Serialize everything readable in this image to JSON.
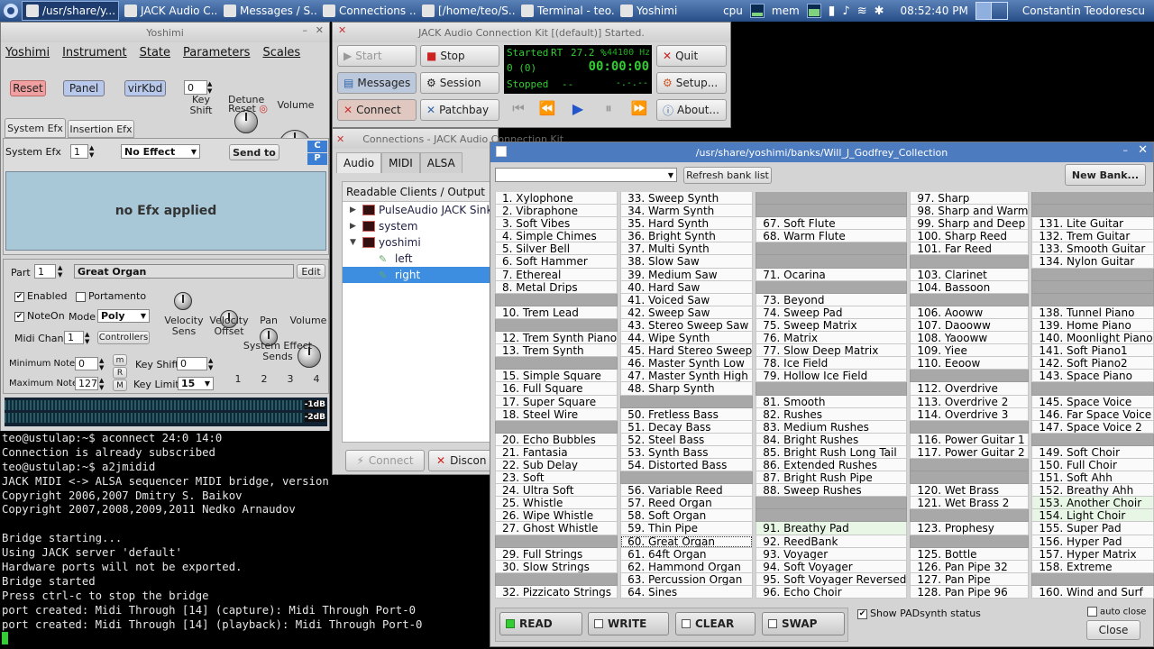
{
  "taskbar": {
    "tasks": [
      "/usr/share/y...",
      "JACK Audio C...",
      "Messages / S...",
      "Connections ...",
      "[/home/teo/S...",
      "Terminal - teo...",
      "Yoshimi"
    ],
    "cpu": "cpu",
    "mem": "mem",
    "clock": "08:52:40 PM",
    "user": "Constantin Teodorescu"
  },
  "yoshimi": {
    "title": "Yoshimi",
    "menu": [
      "Yoshimi",
      "Instrument",
      "State",
      "Parameters",
      "Scales"
    ],
    "reset": "Reset",
    "panel": "Panel",
    "virkbd": "virKbd",
    "key_shift_value": "0",
    "key_shift_label": "Key Shift",
    "detune_label": "Detune",
    "detune_reset": "Reset",
    "volume_label": "Volume",
    "tab_system": "System Efx",
    "tab_insertion": "Insertion Efx",
    "sysefx_label": "System Efx",
    "sysefx_num": "1",
    "effect": "No Effect",
    "send_to": "Send to",
    "c": "C",
    "p": "P",
    "no_efx": "no Efx applied",
    "part_label": "Part",
    "part_num": "1",
    "part_name": "Great Organ",
    "edit": "Edit",
    "enabled": "Enabled",
    "portamento": "Portamento",
    "noteon": "NoteOn",
    "mode_label": "Mode",
    "mode": "Poly",
    "midi_chan_label": "Midi Chan",
    "midi_chan": "1",
    "controllers": "Controllers",
    "vel_sens": "Velocity Sens",
    "vel_offset": "Velocity Offset",
    "pan": "Pan",
    "volume2": "Volume",
    "sys_sends": "System Effect Sends",
    "sends": [
      "1",
      "2",
      "3",
      "4"
    ],
    "min_note_label": "Minimum Note",
    "min_note": "0",
    "max_note_label": "Maximum Note",
    "max_note": "127",
    "m": "m",
    "r": "R",
    "M": "M",
    "key_shift2_label": "Key Shift",
    "key_shift2": "0",
    "key_limit_label": "Key Limit",
    "key_limit": "15",
    "db1": "-1dB",
    "db2": "-2dB"
  },
  "terminal": {
    "lines": [
      "teo@ustulap:~$ aconnect 24:0 14:0",
      "Connection is already subscribed",
      "teo@ustulap:~$ a2jmidid",
      "JACK MIDI <-> ALSA sequencer MIDI bridge, version",
      "Copyright 2006,2007 Dmitry S. Baikov",
      "Copyright 2007,2008,2009,2011 Nedko Arnaudov",
      "",
      "Bridge starting...",
      "Using JACK server 'default'",
      "Hardware ports will not be exported.",
      "Bridge started",
      "Press ctrl-c to stop the bridge",
      "port created: Midi Through [14] (capture): Midi Through Port-0",
      "port created: Midi Through [14] (playback): Midi Through Port-0"
    ]
  },
  "jack": {
    "title": "JACK Audio Connection Kit [(default)] Started.",
    "start": "Start",
    "stop": "Stop",
    "quit": "Quit",
    "messages": "Messages",
    "session": "Session",
    "setup": "Setup...",
    "connect": "Connect",
    "patchbay": "Patchbay",
    "about": "About...",
    "status": "Started",
    "rt": "RT",
    "dsp": "27.2 %",
    "rate": "44100 Hz",
    "xruns": "0 (0)",
    "time": "00:00:00",
    "state": "Stopped",
    "dashes": "--",
    "dots": "-.-.--"
  },
  "connections": {
    "title": "Connections - JACK Audio Connection Kit",
    "tabs": [
      "Audio",
      "MIDI",
      "ALSA"
    ],
    "header": "Readable Clients / Output Por",
    "tree": [
      "PulseAudio JACK Sink",
      "system",
      "yoshimi",
      "left",
      "right"
    ],
    "connect": "Connect",
    "disconnect": "Discon"
  },
  "bank": {
    "title": "/usr/share/yoshimi/banks/Will_J_Godfrey_Collection",
    "refresh": "Refresh bank list",
    "new_bank": "New Bank...",
    "columns": [
      [
        "1. Xylophone",
        "2. Vibraphone",
        "3. Soft Vibes",
        "4. Simple Chimes",
        "5. Silver Bell",
        "6. Soft Hammer",
        "7. Ethereal",
        "8. Metal Drips",
        "",
        "10. Trem Lead",
        "",
        "12. Trem Synth Piano",
        "13. Trem Synth",
        "",
        "15. Simple Square",
        "16. Full Square",
        "17. Super Square",
        "18. Steel Wire",
        "",
        "20. Echo Bubbles",
        "21. Fantasia",
        "22. Sub Delay",
        "23. Soft",
        "24. Ultra Soft",
        "25. Whistle",
        "26. Wipe Whistle",
        "27. Ghost Whistle",
        "",
        "29. Full Strings",
        "30. Slow Strings",
        "",
        "32. Pizzicato Strings"
      ],
      [
        "33. Sweep Synth",
        "34. Warm Synth",
        "35. Hard Synth",
        "36. Bright Synth",
        "37. Multi Synth",
        "38. Slow Saw",
        "39. Medium Saw",
        "40. Hard Saw",
        "41. Voiced Saw",
        "42. Sweep Saw",
        "43. Stereo Sweep Saw",
        "44. Wipe Synth",
        "45. Hard Stereo Sweep",
        "46. Master Synth Low",
        "47. Master Synth High",
        "48. Sharp Synth",
        "",
        "50. Fretless Bass",
        "51. Decay Bass",
        "52. Steel Bass",
        "53. Synth Bass",
        "54. Distorted Bass",
        "",
        "56. Variable Reed",
        "57. Reed Organ",
        "58. Soft Organ",
        "59. Thin Pipe",
        "60. Great Organ",
        "61. 64ft Organ",
        "62. Hammond Organ",
        "63. Percussion Organ",
        "64. Sines"
      ],
      [
        "",
        "",
        "67. Soft Flute",
        "68. Warm Flute",
        "",
        "",
        "71. Ocarina",
        "",
        "73. Beyond",
        "74. Sweep Pad",
        "75. Sweep Matrix",
        "76. Matrix",
        "77. Slow Deep Matrix",
        "78. Ice Field",
        "79. Hollow Ice Field",
        "",
        "81. Smooth",
        "82. Rushes",
        "83. Medium Rushes",
        "84. Bright Rushes",
        "85. Bright Rush Long Tail",
        "86. Extended Rushes",
        "87. Bright Rush Pipe",
        "88. Sweep Rushes",
        "",
        "",
        "91. Breathy Pad",
        "92. ReedBank",
        "93. Voyager",
        "94. Soft Voyager",
        "95. Soft Voyager Reversed",
        "96. Echo Choir"
      ],
      [
        "97. Sharp",
        "98. Sharp and Warm",
        "99. Sharp and Deep",
        "100. Sharp Reed",
        "101. Far Reed",
        "",
        "103. Clarinet",
        "104. Bassoon",
        "",
        "106. Aooww",
        "107. Daooww",
        "108. Yaooww",
        "109. Yiee",
        "110. Eeoow",
        "",
        "112. Overdrive",
        "113. Overdrive 2",
        "114. Overdrive 3",
        "",
        "116. Power Guitar 1",
        "117. Power Guitar 2",
        "",
        "",
        "120. Wet Brass",
        "121. Wet Brass 2",
        "",
        "123. Prophesy",
        "",
        "125. Bottle",
        "126. Pan Pipe 32",
        "127. Pan Pipe",
        "128. Pan Pipe 96"
      ],
      [
        "",
        "",
        "131. Lite Guitar",
        "132. Trem Guitar",
        "133. Smooth Guitar",
        "134. Nylon Guitar",
        "",
        "",
        "",
        "138. Tunnel Piano",
        "139. Home Piano",
        "140. Moonlight Piano",
        "141. Soft Piano1",
        "142. Soft Piano2",
        "143. Space Piano",
        "",
        "145. Space Voice",
        "146. Far Space Voice",
        "147. Space Voice 2",
        "",
        "149. Soft Choir",
        "150. Full Choir",
        "151. Soft Ahh",
        "152. Breathy Ahh",
        "153. Another Choir",
        "154. Light Choir",
        "155. Super Pad",
        "156. Hyper Pad",
        "157. Hyper Matrix",
        "158. Extreme",
        "",
        "160. Wind and Surf"
      ]
    ],
    "read": "READ",
    "write": "WRITE",
    "clear": "CLEAR",
    "swap": "SWAP",
    "show_padsynth": "Show PADsynth status",
    "auto_close": "auto close",
    "close": "Close"
  }
}
